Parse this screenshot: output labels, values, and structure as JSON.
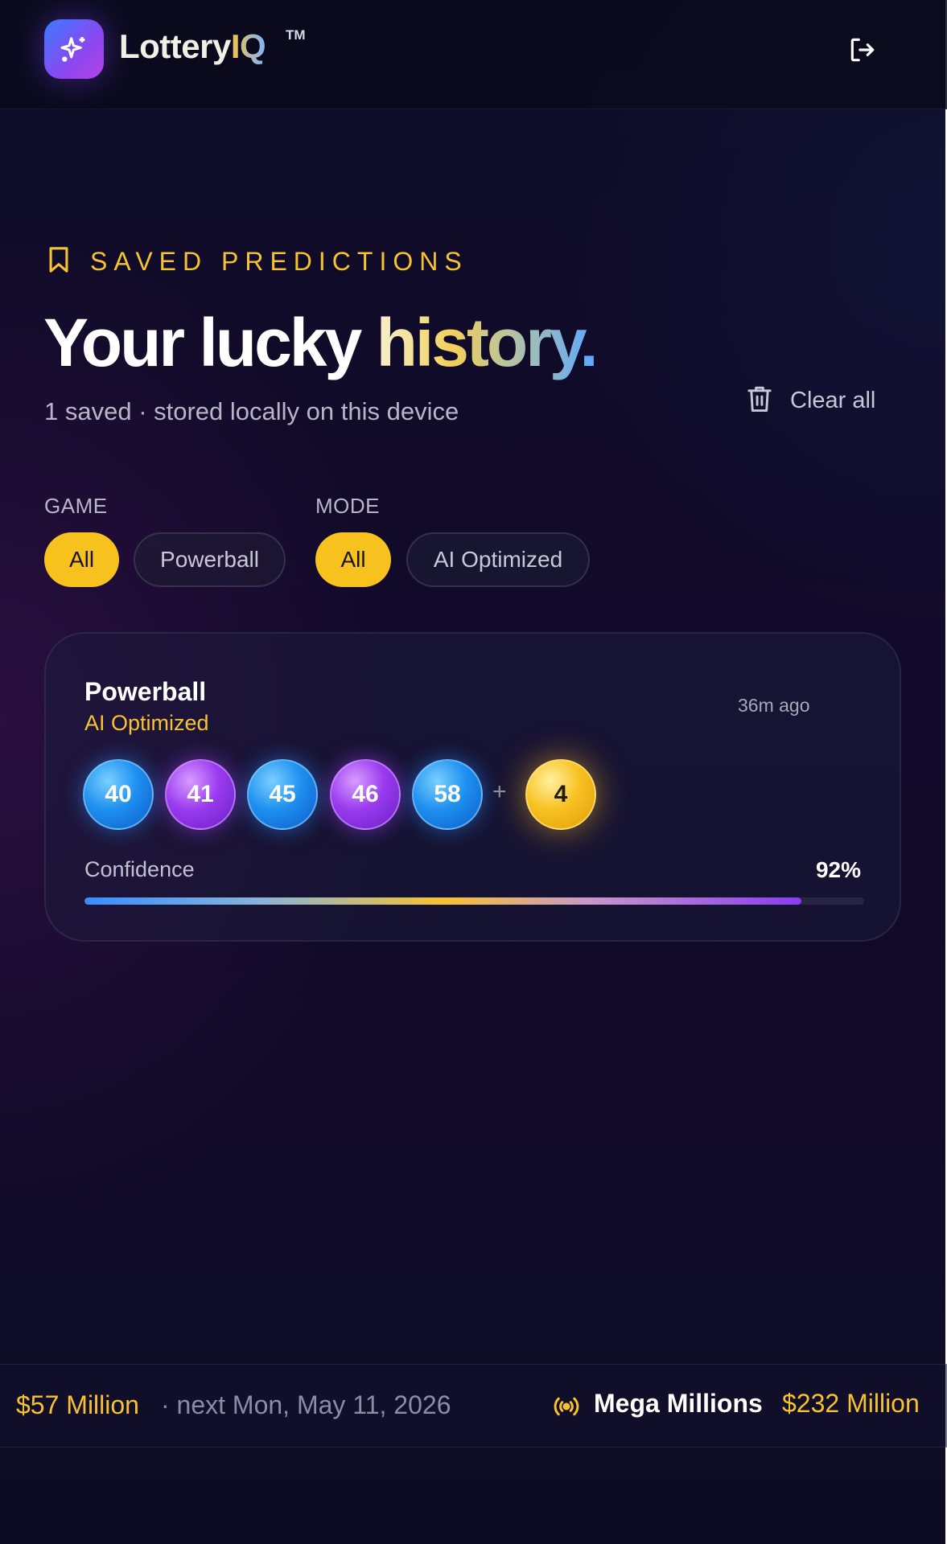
{
  "header": {
    "brand_part1": "Lottery",
    "brand_part2": "IQ",
    "trademark": "TM",
    "logo_icon": "sparkles-icon",
    "logout_icon": "logout-icon"
  },
  "section": {
    "eyebrow_icon": "bookmark-icon",
    "eyebrow": "SAVED PREDICTIONS",
    "title_part1": "Your lucky ",
    "title_part2": "history.",
    "subtitle": "1 saved · stored locally on this device",
    "clear_all_icon": "trash-icon",
    "clear_all_label": "Clear all"
  },
  "filters": {
    "game": {
      "label": "GAME",
      "options": [
        "All",
        "Powerball"
      ],
      "selected": "All"
    },
    "mode": {
      "label": "MODE",
      "options": [
        "All",
        "AI Optimized"
      ],
      "selected": "All"
    }
  },
  "predictions": [
    {
      "game": "Powerball",
      "mode": "AI Optimized",
      "time_ago": "36m ago",
      "balls": [
        {
          "value": "40",
          "color": "blue"
        },
        {
          "value": "41",
          "color": "purple"
        },
        {
          "value": "45",
          "color": "blue"
        },
        {
          "value": "46",
          "color": "purple"
        },
        {
          "value": "58",
          "color": "blue"
        }
      ],
      "plus": "+",
      "bonus_ball": "4",
      "confidence_label": "Confidence",
      "confidence_value": "92%",
      "confidence_fraction": 0.92
    }
  ],
  "ticker": {
    "amount1": "$57 Million",
    "next_draw": "· next Mon, May 11, 2026",
    "broadcast_icon": "broadcast-icon",
    "game": "Mega Millions",
    "amount2": "$232 Million"
  },
  "colors": {
    "accent_gold": "#f7c232",
    "ball_blue": "#1e90f0",
    "ball_purple": "#9a3bef",
    "background": "#0e0c26"
  }
}
